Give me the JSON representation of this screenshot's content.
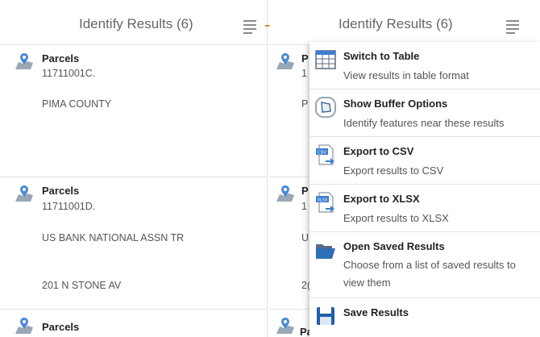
{
  "header": {
    "title": "Identify Results (6)"
  },
  "results": [
    {
      "layer": "Parcels",
      "id": "11711001C.",
      "owner": "PIMA COUNTY",
      "address": ""
    },
    {
      "layer": "Parcels",
      "id": "11711001D.",
      "owner": "US BANK NATIONAL ASSN TR",
      "address": "201  N  STONE AV"
    },
    {
      "layer": "Parcels"
    }
  ],
  "right_results": [
    {
      "layer": "P",
      "id": "1",
      "owner": "P",
      "address": ""
    },
    {
      "layer": "P",
      "id": "1",
      "owner": "U",
      "address": "2("
    },
    {
      "layer": "Parcels"
    }
  ],
  "menu": {
    "items": [
      {
        "title": "Switch to Table",
        "desc": "View results in table format",
        "icon": "table-icon"
      },
      {
        "title": "Show Buffer Options",
        "desc": "Identify features near these results",
        "icon": "buffer-icon"
      },
      {
        "title": "Export to CSV",
        "desc": "Export results to CSV",
        "icon": "csv-export-icon"
      },
      {
        "title": "Export to XLSX",
        "desc": "Export results to XLSX",
        "icon": "xlsx-export-icon"
      },
      {
        "title": "Open Saved Results",
        "desc": "Choose from a list of saved results to view them",
        "icon": "folder-open-icon"
      },
      {
        "title": "Save Results",
        "desc": "",
        "icon": "save-icon"
      }
    ],
    "icon_labels": {
      "csv": "CSV",
      "xlsx": "XLSX"
    }
  },
  "colors": {
    "arrow": "#f07c22",
    "pin": "#4a8bd6",
    "map": "#9aa7b5"
  }
}
